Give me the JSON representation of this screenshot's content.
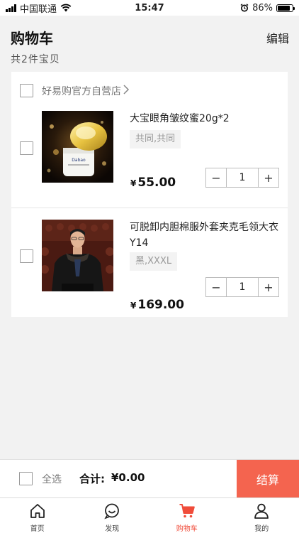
{
  "status_bar": {
    "carrier": "中国联通",
    "time": "15:47",
    "battery": "86%",
    "battery_level": 0.86
  },
  "header": {
    "title": "购物车",
    "edit_label": "编辑",
    "count_text": "共2件宝贝"
  },
  "shop": {
    "name": "好易购官方自营店"
  },
  "items": [
    {
      "title": "大宝眼角皱纹蜜20g*2",
      "spec": "共同,共同",
      "price": "55.00",
      "currency": "¥",
      "quantity": "1",
      "image": "cream-jar-product-photo"
    },
    {
      "title": " 可脱卸内胆棉服外套夹克毛领大衣 Y14",
      "spec": "黑,XXXL",
      "price": "169.00",
      "currency": "¥",
      "quantity": "1",
      "image": "man-in-black-coat-photo"
    }
  ],
  "stepper": {
    "minus": "−",
    "plus": "+"
  },
  "checkout": {
    "select_all": "全选",
    "total_label": "合计:",
    "total_value": "¥0.00",
    "settle_label": "结算"
  },
  "tabs": [
    {
      "label": "首页",
      "icon": "home-icon"
    },
    {
      "label": "发现",
      "icon": "discover-icon"
    },
    {
      "label": "购物车",
      "icon": "cart-icon",
      "active": true
    },
    {
      "label": "我的",
      "icon": "user-icon"
    }
  ],
  "colors": {
    "accent": "#f4644f",
    "active_tab": "#f04c3a",
    "background": "#f2f2f2"
  }
}
